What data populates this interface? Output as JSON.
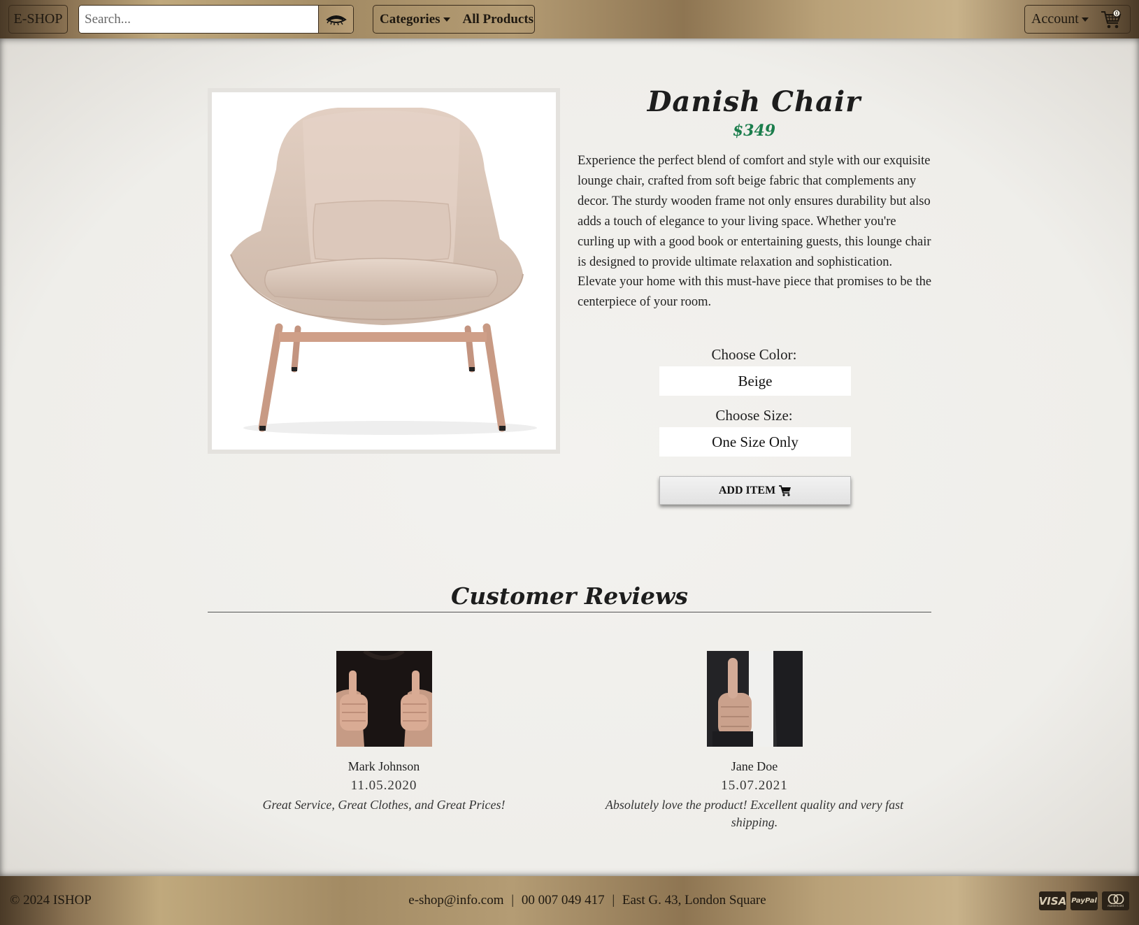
{
  "navbar": {
    "brand": "E-SHOP",
    "search_placeholder": "Search...",
    "categories_label": "Categories",
    "all_products_label": "All Products",
    "account_label": "Account",
    "cart_count": "0"
  },
  "product": {
    "title": "Danish Chair",
    "price": "$349",
    "description": "Experience the perfect blend of comfort and style with our exquisite lounge chair, crafted from soft beige fabric that complements any decor. The sturdy wooden frame not only ensures durability but also adds a touch of elegance to your living space. Whether you're curling up with a good book or entertaining guests, this lounge chair is designed to provide ultimate relaxation and sophistication. Elevate your home with this must-have piece that promises to be the centerpiece of your room.",
    "color_label": "Choose Color:",
    "color_value": "Beige",
    "size_label": "Choose Size:",
    "size_value": "One Size Only",
    "add_button": "ADD ITEM"
  },
  "reviews": {
    "title": "Customer Reviews",
    "items": [
      {
        "name": "Mark Johnson",
        "date": "11.05.2020",
        "text": "Great Service, Great Clothes, and Great Prices!"
      },
      {
        "name": "Jane Doe",
        "date": "15.07.2021",
        "text": "Absolutely love the product! Excellent quality and very fast shipping."
      }
    ]
  },
  "footer": {
    "copyright": "© 2024 ISHOP",
    "email": "e-shop@info.com",
    "phone": "00 007 049 417",
    "address": "East G. 43, London Square",
    "separator": "|",
    "payments": [
      "VISA",
      "PayPal",
      "mastercard"
    ]
  },
  "icons": {
    "search": "eye-icon",
    "cart": "cart-icon",
    "add_cart": "cart-icon",
    "payments": [
      "visa-icon",
      "paypal-icon",
      "mastercard-icon"
    ]
  }
}
